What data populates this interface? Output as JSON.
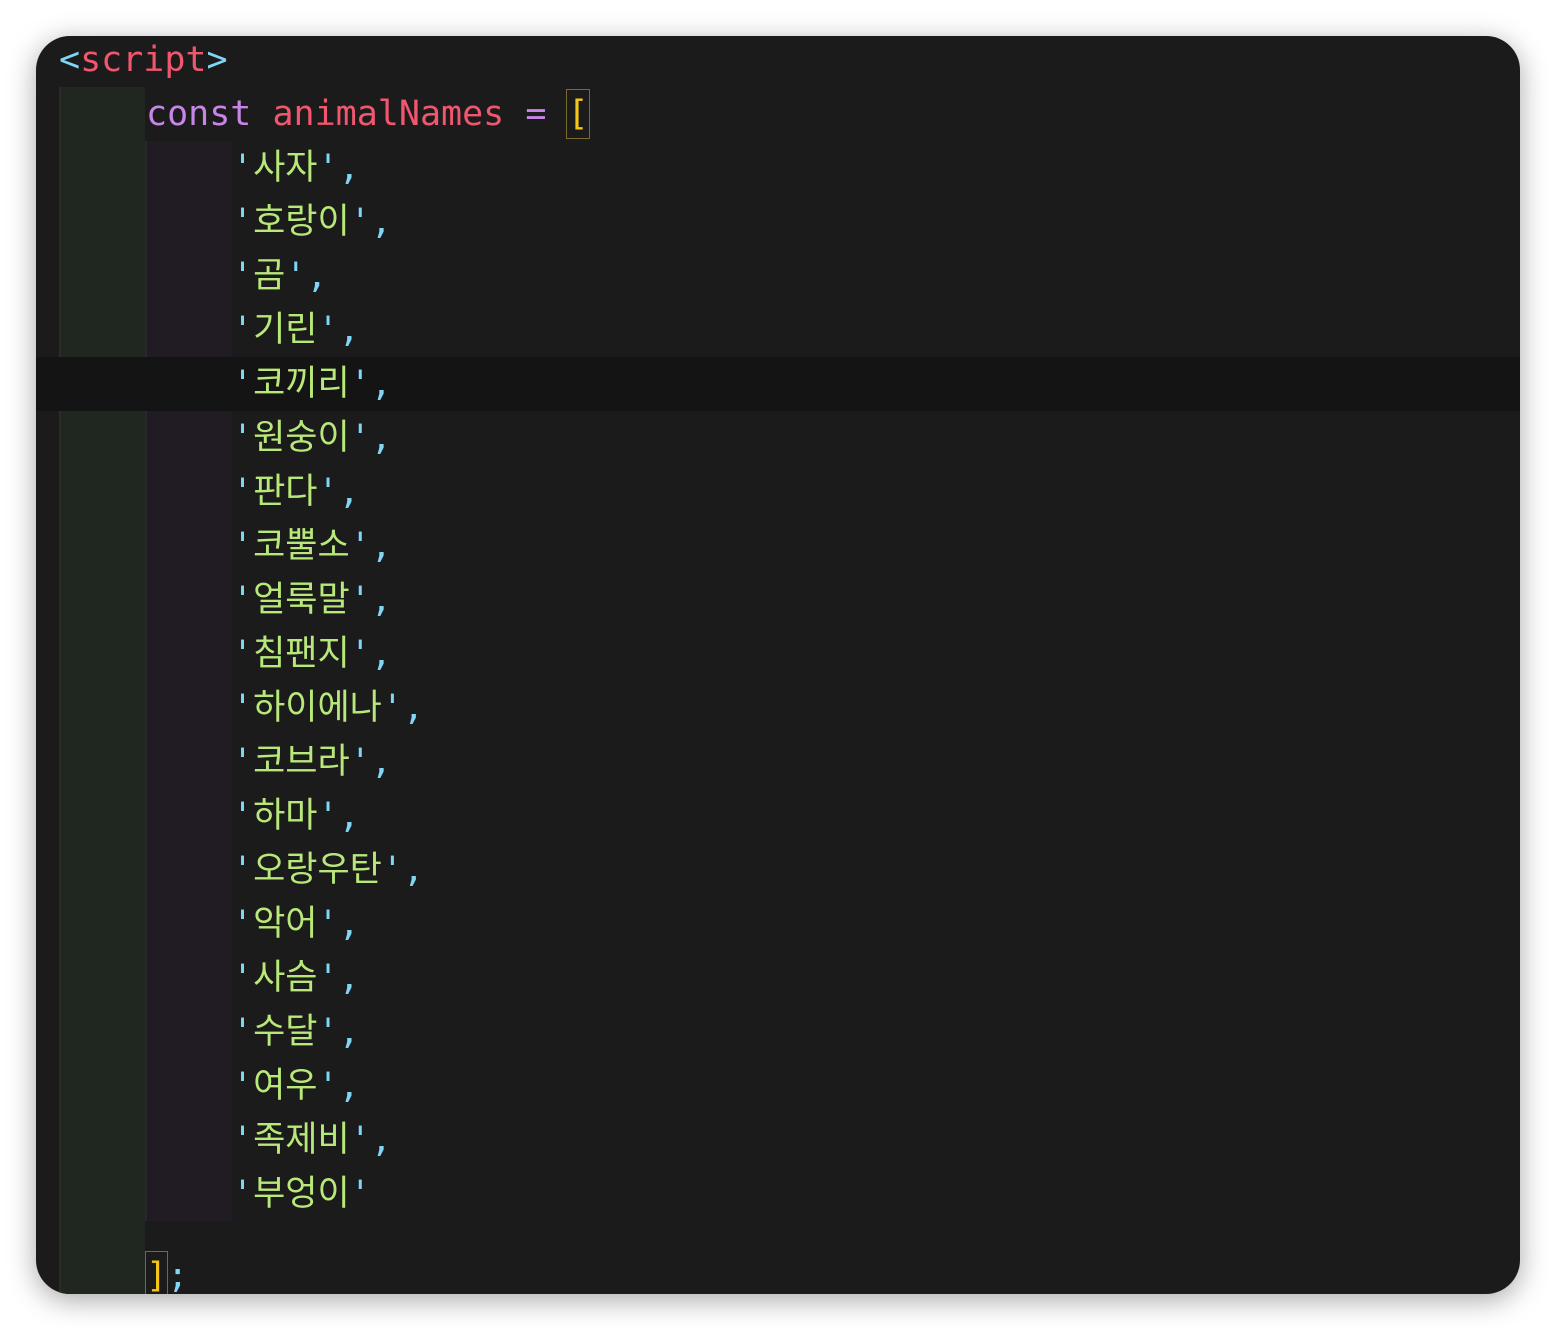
{
  "editor": {
    "open_tag": "script",
    "keyword": "const",
    "variable": "animalNames",
    "operator": "=",
    "open_bracket": "[",
    "close_bracket": "]",
    "terminator": ";",
    "animals": [
      "사자",
      "호랑이",
      "곰",
      "기린",
      "코끼리",
      "원숭이",
      "판다",
      "코뿔소",
      "얼룩말",
      "침팬지",
      "하이에나",
      "코브라",
      "하마",
      "오랑우탄",
      "악어",
      "사슴",
      "수달",
      "여우",
      "족제비",
      "부엉이"
    ],
    "current_line_index": 4
  }
}
